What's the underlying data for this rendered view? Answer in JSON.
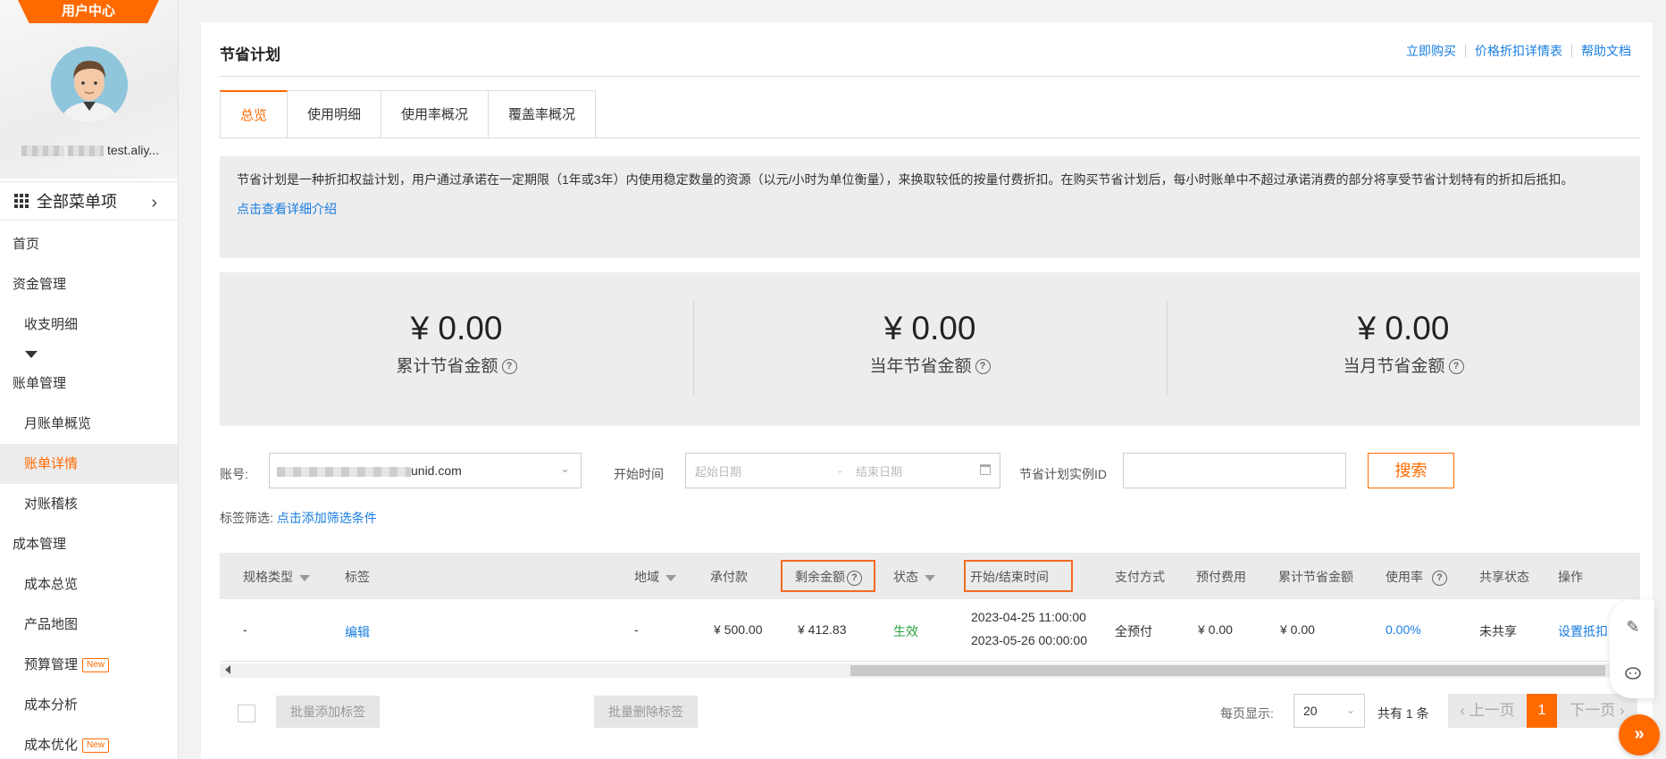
{
  "sidebar": {
    "user_center": "用户中心",
    "username_suffix": "test.aliy...",
    "all_menu": "全部菜单项",
    "items": [
      {
        "label": "首页",
        "type": "group"
      },
      {
        "label": "资金管理",
        "type": "group"
      },
      {
        "label": "收支明细",
        "type": "sub"
      },
      {
        "label": "账单管理",
        "type": "group"
      },
      {
        "label": "月账单概览",
        "type": "sub"
      },
      {
        "label": "账单详情",
        "type": "sub",
        "active": true
      },
      {
        "label": "对账稽核",
        "type": "sub"
      },
      {
        "label": "成本管理",
        "type": "group"
      },
      {
        "label": "成本总览",
        "type": "sub"
      },
      {
        "label": "产品地图",
        "type": "sub"
      },
      {
        "label": "预算管理",
        "type": "sub",
        "badge": "New"
      },
      {
        "label": "成本分析",
        "type": "sub"
      },
      {
        "label": "成本优化",
        "type": "sub",
        "badge": "New"
      }
    ]
  },
  "header": {
    "title": "节省计划",
    "links": [
      "立即购买",
      "价格折扣详情表",
      "帮助文档"
    ]
  },
  "tabs": [
    "总览",
    "使用明细",
    "使用率概况",
    "覆盖率概况"
  ],
  "intro": {
    "text": "节省计划是一种折扣权益计划，用户通过承诺在一定期限（1年或3年）内使用稳定数量的资源（以元/小时为单位衡量），来换取较低的按量付费折扣。在购买节省计划后，每小时账单中不超过承诺消费的部分将享受节省计划特有的折扣后抵扣。",
    "link": "点击查看详细介绍"
  },
  "stats": [
    {
      "value": "¥ 0.00",
      "label": "累计节省金额"
    },
    {
      "value": "¥ 0.00",
      "label": "当年节省金额"
    },
    {
      "value": "¥ 0.00",
      "label": "当月节省金额"
    }
  ],
  "filters": {
    "account_label": "账号:",
    "account_value": "unid.com",
    "start_label": "开始时间",
    "start_placeholder": "起始日期",
    "end_placeholder": "结束日期",
    "date_sep": "-",
    "instance_label": "节省计划实例ID",
    "search": "搜索",
    "tag_label": "标签筛选:",
    "tag_link": "点击添加筛选条件"
  },
  "table": {
    "headers": [
      "规格类型",
      "标签",
      "地域",
      "承付款",
      "剩余金额",
      "状态",
      "开始/结束时间",
      "支付方式",
      "预付费用",
      "累计节省金额",
      "使用率",
      "共享状态",
      "操作"
    ],
    "row": {
      "spec": "-",
      "tag": "编辑",
      "region": "-",
      "commitment": "¥ 500.00",
      "remaining": "¥ 412.83",
      "status": "生效",
      "start": "2023-04-25 11:00:00",
      "end": "2023-05-26 00:00:00",
      "payment": "全预付",
      "prepaid": "¥ 0.00",
      "saved": "¥ 0.00",
      "usage": "0.00%",
      "share": "未共享",
      "action": "设置抵扣"
    }
  },
  "bottom": {
    "batch_add": "批量添加标签",
    "batch_remove": "批量删除标签",
    "page_size_label": "每页显示:",
    "page_size": "20",
    "total": "共有 1 条",
    "prev": "上一页",
    "current": "1",
    "next": "下一页"
  },
  "colors": {
    "accent": "#ff6a00",
    "link": "#1a7ee0",
    "ok": "#2aa143"
  }
}
